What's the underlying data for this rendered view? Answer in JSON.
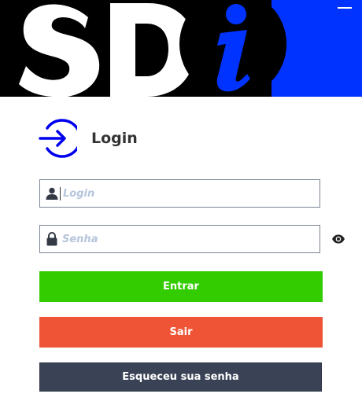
{
  "banner": {
    "logo_text": "SDi",
    "minimize_label": "Minimize"
  },
  "header": {
    "title": "Login",
    "icon": "login-arrow-icon"
  },
  "form": {
    "username": {
      "placeholder": "Login",
      "value": "",
      "icon": "user-icon"
    },
    "password": {
      "placeholder": "Senha",
      "value": "",
      "icon": "lock-icon",
      "toggle_icon": "eye-icon"
    }
  },
  "buttons": {
    "entrar": "Entrar",
    "sair": "Sair",
    "esqueceu": "Esqueceu sua senha"
  },
  "colors": {
    "banner_black": "#000000",
    "banner_blue": "#0033ff",
    "accent_blue": "#0000ee",
    "entrar_green": "#33cc00",
    "sair_red": "#ee5435",
    "esqueceu_navy": "#3a4356"
  }
}
